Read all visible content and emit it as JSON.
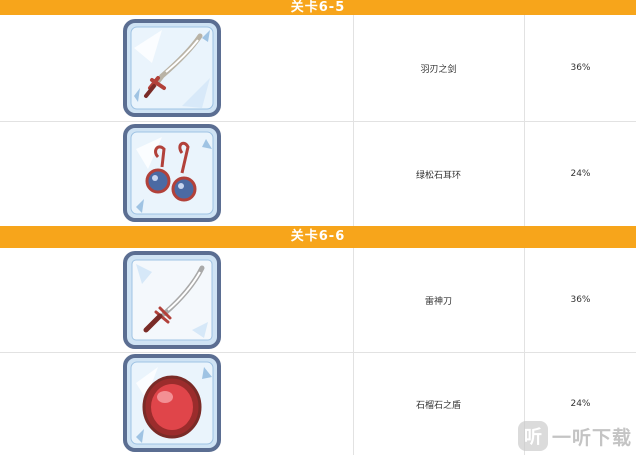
{
  "stages": [
    {
      "title": "关卡6-5",
      "items": [
        {
          "name": "羽刃之剑",
          "rate": "36%",
          "icon": "feather-blade-icon"
        },
        {
          "name": "绿松石耳环",
          "rate": "24%",
          "icon": "turquoise-earring-icon"
        }
      ]
    },
    {
      "title": "关卡6-6",
      "items": [
        {
          "name": "雷神刀",
          "rate": "36%",
          "icon": "thunder-sword-icon"
        },
        {
          "name": "石榴石之盾",
          "rate": "24%",
          "icon": "garnet-shield-icon"
        }
      ]
    }
  ],
  "watermark": {
    "logo": "听",
    "text": "一听下载"
  },
  "colors": {
    "header": "#f7a51b",
    "grid": "#e2e2e2",
    "frame": "#5b6e92"
  }
}
